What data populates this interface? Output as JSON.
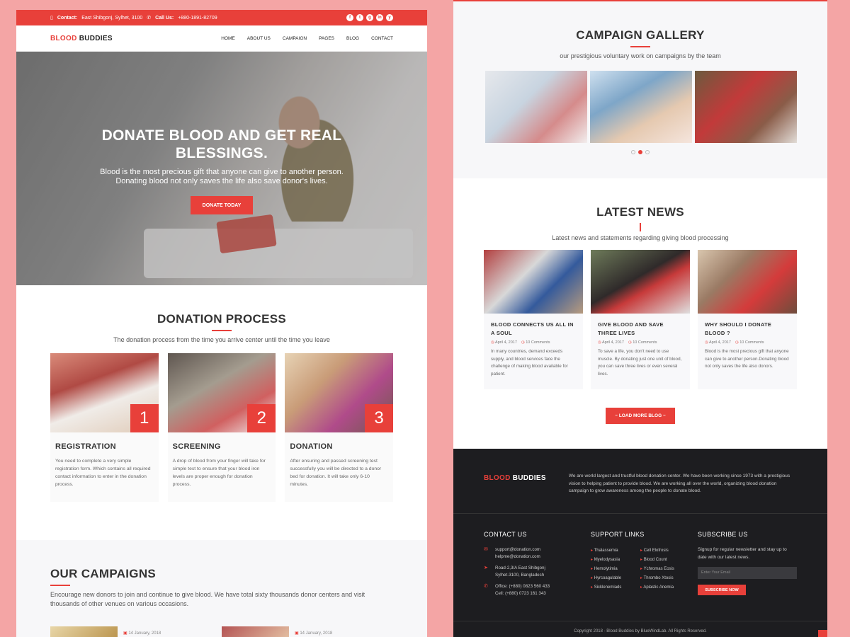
{
  "topbar": {
    "contact_label": "Contact:",
    "contact_value": "East Shibgonj, Sylhet, 3100",
    "call_label": "Call Us:",
    "call_value": "+880-1891-82709",
    "socials": [
      "f",
      "t",
      "g",
      "in",
      "y"
    ]
  },
  "brand": {
    "part1": "BLOOD",
    "part2": "BUDDIES"
  },
  "nav": [
    "HOME",
    "ABOUT US",
    "CAMPAIGN",
    "PAGES",
    "BLOG",
    "CONTACT"
  ],
  "hero": {
    "title": "DONATE BLOOD AND GET REAL BLESSINGS.",
    "text1": "Blood is the most precious gift that anyone can give to another person.",
    "text2": "Donating blood not only saves the life also save donor's lives.",
    "button": "DONATE TODAY"
  },
  "process": {
    "title": "DONATION PROCESS",
    "subtitle": "The donation process from the time you arrive center until the time you leave",
    "steps": [
      {
        "num": "1",
        "title": "REGISTRATION",
        "text": "You need to complete a very simple registration form. Which contains all required contact information to enter in the donation process."
      },
      {
        "num": "2",
        "title": "SCREENING",
        "text": "A drop of blood from your finger will take for simple test to ensure that your blood iron levels are proper enough for donation process."
      },
      {
        "num": "3",
        "title": "DONATION",
        "text": "After ensuring and passed screening test successfully you will be directed to a donor bed for donation. It will take only 6-10 minutes."
      }
    ]
  },
  "campaigns": {
    "title": "OUR CAMPAIGNS",
    "text": "Encourage new donors to join and continue to give blood. We have total sixty thousands donor centers and visit thousands of other venues on various occasions.",
    "dates": [
      "14 January, 2018",
      "14 January, 2018"
    ]
  },
  "gallery": {
    "title": "CAMPAIGN GALLERY",
    "subtitle": "our prestigious voluntary work on campaigns by the team"
  },
  "news": {
    "title": "LATEST NEWS",
    "subtitle": "Latest news and statements regarding giving blood processing",
    "items": [
      {
        "title": "BLOOD CONNECTS US ALL IN A SOUL",
        "date": "April 4, 2017",
        "comments": "10 Comments",
        "text": "In many countries, demand exceeds supply, and blood services face the challenge of making blood available for patient."
      },
      {
        "title": "GIVE BLOOD AND SAVE THREE LIVES",
        "date": "April 4, 2017",
        "comments": "10 Comments",
        "text": "To save a life, you don't need to use muscle. By donating just one unit of blood, you can save three lives or even several lives."
      },
      {
        "title": "WHY SHOULD I DONATE BLOOD ?",
        "date": "April 4, 2017",
        "comments": "10 Comments",
        "text": "Blood is the most precious gift that anyone can give to another person.Donating blood not only saves the life also donors."
      }
    ],
    "load_more": "~ LOAD MORE BLOG ~"
  },
  "footer": {
    "about": "We are world largest and trustful blood donation center. We have been working since 1973 with a prestigious vision to helping patient to provide blood. We are working all over the world, organizing blood donation campaign to grow awareness among the people to donate blood.",
    "contact_title": "CONTACT US",
    "email1": "support@donation.com",
    "email2": "helpme@donation.com",
    "address1": "Road-2,3/A East Shibgonj",
    "address2": "Sylhet-3100, Bangladesh",
    "office": "Office: (+880) 0823 560 433",
    "cell": "Cell: (+880) 0723 161 343",
    "support_title": "SUPPORT LINKS",
    "links": [
      "Thalassemia",
      "Cell Elofrosis",
      "Myelodysasia",
      "Blood Count",
      "Hemolytimia",
      "Ychromas Eosis",
      "Hyrcoagulable",
      "Thrombo Xtosis",
      "Sicklenemiads",
      "Aplastic Anemia"
    ],
    "subscribe_title": "SUBSCRIBE US",
    "subscribe_text": "Signup for regular newsletter and stay up to date with our latest news.",
    "email_placeholder": "Enter Your Email",
    "subscribe_button": "SUBSCRIBE NOW",
    "copyright": "Copyright 2018 - Blood Buddies by BlueWindLab. All Rights Reserved."
  }
}
